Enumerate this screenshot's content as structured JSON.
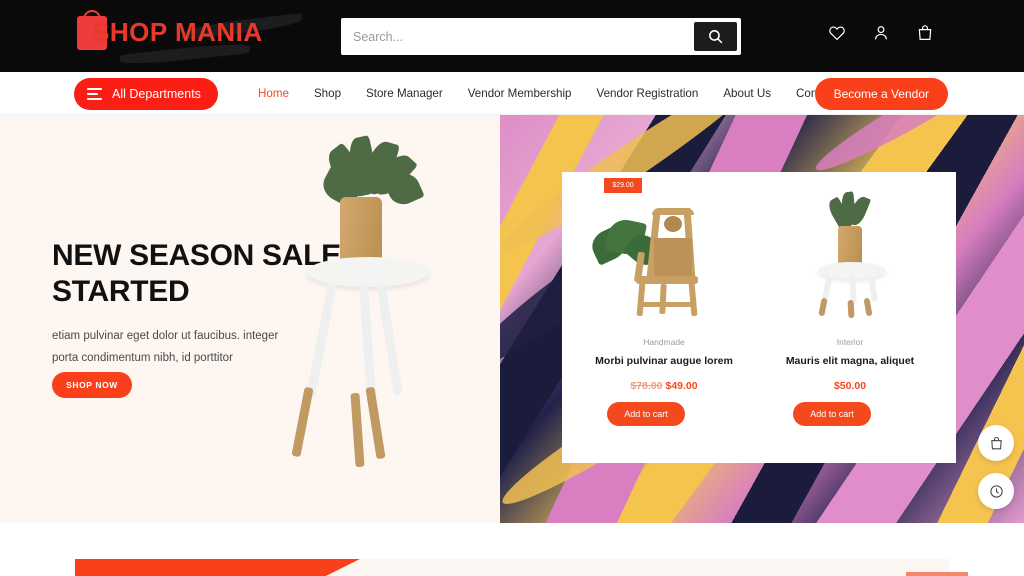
{
  "header": {
    "logo_text": "SHOP MANIA",
    "logo_icon": "shopping-bag-icon",
    "search": {
      "placeholder": "Search...",
      "value": "",
      "button_icon": "search-icon"
    },
    "icons": [
      {
        "name": "wishlist-icon",
        "glyph": "heart"
      },
      {
        "name": "account-icon",
        "glyph": "user"
      },
      {
        "name": "cart-icon",
        "glyph": "bag"
      }
    ]
  },
  "nav": {
    "departments_label": "All Departments",
    "departments_icon": "hamburger-menu-icon",
    "links": [
      {
        "label": "Home",
        "active": true
      },
      {
        "label": "Shop",
        "active": false
      },
      {
        "label": "Store Manager",
        "active": false
      },
      {
        "label": "Vendor Membership",
        "active": false
      },
      {
        "label": "Vendor Registration",
        "active": false
      },
      {
        "label": "About Us",
        "active": false
      },
      {
        "label": "Contact",
        "active": false
      }
    ],
    "vendor_button": "Become a Vendor"
  },
  "hero": {
    "title": "NEW SEASON SALE STARTED",
    "description": "etiam pulvinar eget dolor ut faucibus. integer porta condimentum nibh, id porttitor",
    "cta_label": "SHOP NOW"
  },
  "promo_card": {
    "badge_price": "$29.00",
    "products": [
      {
        "category": "Handmade",
        "name": "Morbi pulvinar augue lorem",
        "old_price": "$78.00",
        "price": "$49.00",
        "button_label": "Add to cart"
      },
      {
        "category": "Interior",
        "name": "Mauris elit magna, aliquet",
        "old_price": "",
        "price": "$50.00",
        "button_label": "Add to cart"
      }
    ]
  },
  "floating_buttons": [
    {
      "name": "floating-cart-button",
      "icon": "shopping-bag-icon"
    },
    {
      "name": "floating-recent-button",
      "icon": "clock-icon"
    }
  ],
  "colors": {
    "accent": "#f9401b",
    "accent_alt": "#fa1e14",
    "header_bg": "#0a0a0a",
    "hero_bg": "#fdf6f1",
    "text_dark": "#111111",
    "muted": "#9b9b9b"
  }
}
